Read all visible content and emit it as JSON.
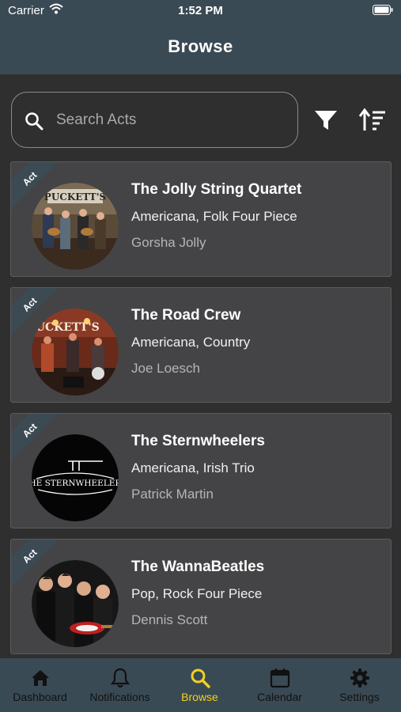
{
  "status_bar": {
    "carrier": "Carrier",
    "time": "1:52 PM"
  },
  "header": {
    "title": "Browse"
  },
  "search": {
    "placeholder": "Search Acts",
    "value": ""
  },
  "toolbar": {
    "filter_icon": "filter-icon",
    "sort_icon": "sort-icon"
  },
  "acts": [
    {
      "badge": "Act",
      "title": "The Jolly String Quartet",
      "genre": "Americana, Folk Four Piece",
      "contact": "Gorsha Jolly"
    },
    {
      "badge": "Act",
      "title": "The Road Crew",
      "genre": "Americana, Country",
      "contact": "Joe Loesch"
    },
    {
      "badge": "Act",
      "title": "The Sternwheelers",
      "genre": "Americana, Irish Trio",
      "contact": "Patrick Martin"
    },
    {
      "badge": "Act",
      "title": "The WannaBeatles",
      "genre": "Pop, Rock Four Piece",
      "contact": "Dennis Scott"
    }
  ],
  "image_text": {
    "sign": "PUCKETT'S",
    "logo": "THE STERNWHEELERS"
  },
  "tabs": [
    {
      "label": "Dashboard",
      "icon": "home-icon"
    },
    {
      "label": "Notifications",
      "icon": "bell-icon"
    },
    {
      "label": "Browse",
      "icon": "search-icon",
      "active": true
    },
    {
      "label": "Calendar",
      "icon": "calendar-icon"
    },
    {
      "label": "Settings",
      "icon": "gear-icon"
    }
  ],
  "colors": {
    "header": "#3a4a54",
    "background": "#2f2f30",
    "card": "#444446",
    "active_tab": "#f2d21b"
  }
}
